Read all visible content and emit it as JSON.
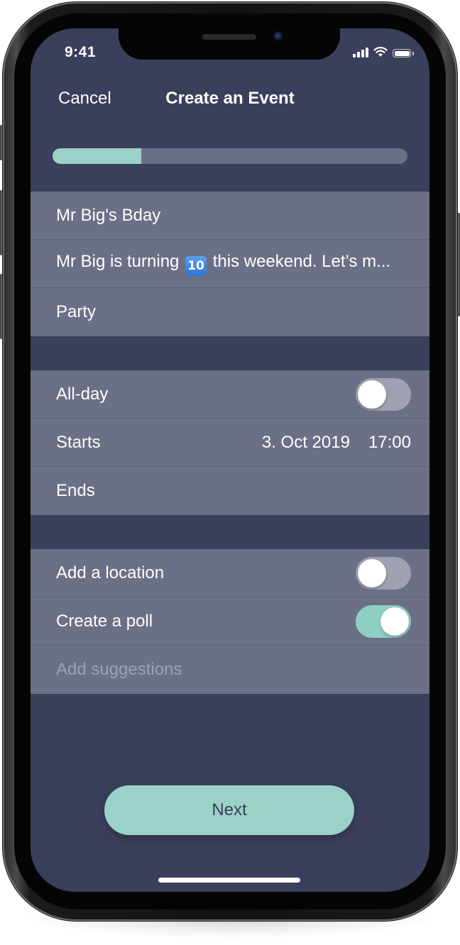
{
  "status_bar": {
    "time": "9:41"
  },
  "nav": {
    "cancel_label": "Cancel",
    "title": "Create an Event"
  },
  "progress": {
    "fraction": 0.25
  },
  "event_details": {
    "name": "Mr Big's Bday",
    "description_before": "Mr Big is turning",
    "description_emoji": "🔟",
    "description_after": "this weekend. Let’s m...",
    "category": "Party"
  },
  "time_section": {
    "all_day_label": "All-day",
    "all_day_on": false,
    "starts_label": "Starts",
    "starts_date": "3. Oct 2019",
    "starts_time": "17:00",
    "ends_label": "Ends"
  },
  "options_section": {
    "location_label": "Add a location",
    "location_on": false,
    "poll_label": "Create a poll",
    "poll_on": true,
    "suggestions_placeholder": "Add suggestions"
  },
  "next_button": {
    "label": "Next"
  },
  "colors": {
    "background": "#3a3f5c",
    "row": "#6c7086",
    "accent": "#9bd2c8"
  }
}
